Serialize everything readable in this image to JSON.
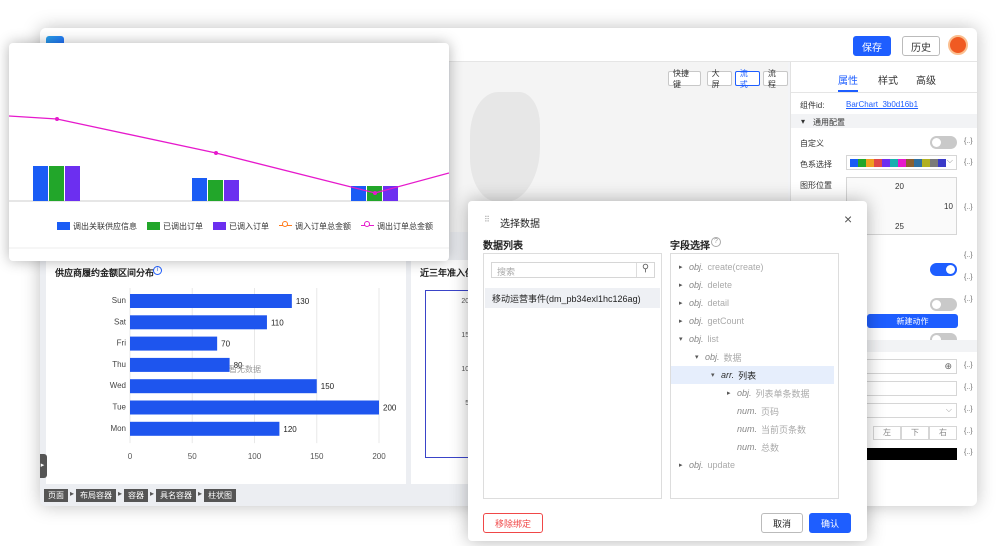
{
  "topbar": {
    "save": "保存",
    "history": "历史"
  },
  "toolbar": {
    "shortcut": "快捷键",
    "big": "大屏",
    "flow": "流式",
    "process": "流程"
  },
  "rightpanel": {
    "tabs": [
      "属性",
      "样式",
      "高级"
    ],
    "component_id_label": "组件id:",
    "component_id": "BarChart_3b0d16b1",
    "general": "通用配置",
    "custom": "自定义",
    "color_select": "色系选择",
    "position": "图形位置",
    "pos_top": "20",
    "pos_right": "10",
    "pos_bottom": "25",
    "new_action": "新建动作",
    "dir": [
      "左",
      "下",
      "右"
    ],
    "more": "{..}"
  },
  "topchart": {
    "legend": [
      "调出关联供应信息",
      "已调出订单",
      "已调入订单",
      "调入订单总金额",
      "调出订单总金额"
    ],
    "colors": [
      "#1a5cf5",
      "#22a62a",
      "#6c2ff0",
      "#ff7a1a",
      "#e619cc"
    ]
  },
  "chart_data": {
    "type": "bar",
    "title": "供应商履约金额区间分布",
    "categories": [
      "Sun",
      "Sat",
      "Fri",
      "Thu",
      "Wed",
      "Tue",
      "Mon"
    ],
    "values": [
      130,
      110,
      70,
      80,
      150,
      200,
      120
    ],
    "xticks": [
      0,
      50,
      100,
      150,
      200
    ],
    "xlim": [
      0,
      200
    ],
    "watermark": "暂无数据"
  },
  "secondchart": {
    "title": "近三年准入供",
    "ticks": [
      "200",
      "150",
      "100",
      "50",
      "0"
    ]
  },
  "breadcrumb": [
    "页面",
    "布局容器",
    "容器",
    "具名容器",
    "柱状图"
  ],
  "dialog": {
    "title": "选择数据",
    "data_list": "数据列表",
    "field_select": "字段选择",
    "search": "搜索",
    "item": "移动运营事件(dm_pb34exl1hc126ag)",
    "tree": [
      {
        "lvl": 0,
        "type": "obj.",
        "name": "create(create)",
        "tri": "▸"
      },
      {
        "lvl": 0,
        "type": "obj.",
        "name": "delete",
        "tri": "▸"
      },
      {
        "lvl": 0,
        "type": "obj.",
        "name": "detail",
        "tri": "▸"
      },
      {
        "lvl": 0,
        "type": "obj.",
        "name": "getCount",
        "tri": "▸"
      },
      {
        "lvl": 0,
        "type": "obj.",
        "name": "list",
        "tri": "▾"
      },
      {
        "lvl": 1,
        "type": "obj.",
        "name": "数据",
        "tri": "▾"
      },
      {
        "lvl": 2,
        "type": "arr.",
        "name": "列表",
        "tri": "▾",
        "sel": true
      },
      {
        "lvl": 3,
        "type": "obj.",
        "name": "列表单条数据",
        "tri": "▸"
      },
      {
        "lvl": 3,
        "type": "num.",
        "name": "页码",
        "tri": ""
      },
      {
        "lvl": 3,
        "type": "num.",
        "name": "当前页条数",
        "tri": ""
      },
      {
        "lvl": 3,
        "type": "num.",
        "name": "总数",
        "tri": ""
      },
      {
        "lvl": 0,
        "type": "obj.",
        "name": "update",
        "tri": "▸"
      }
    ],
    "unbind": "移除绑定",
    "cancel": "取消",
    "ok": "确认"
  }
}
